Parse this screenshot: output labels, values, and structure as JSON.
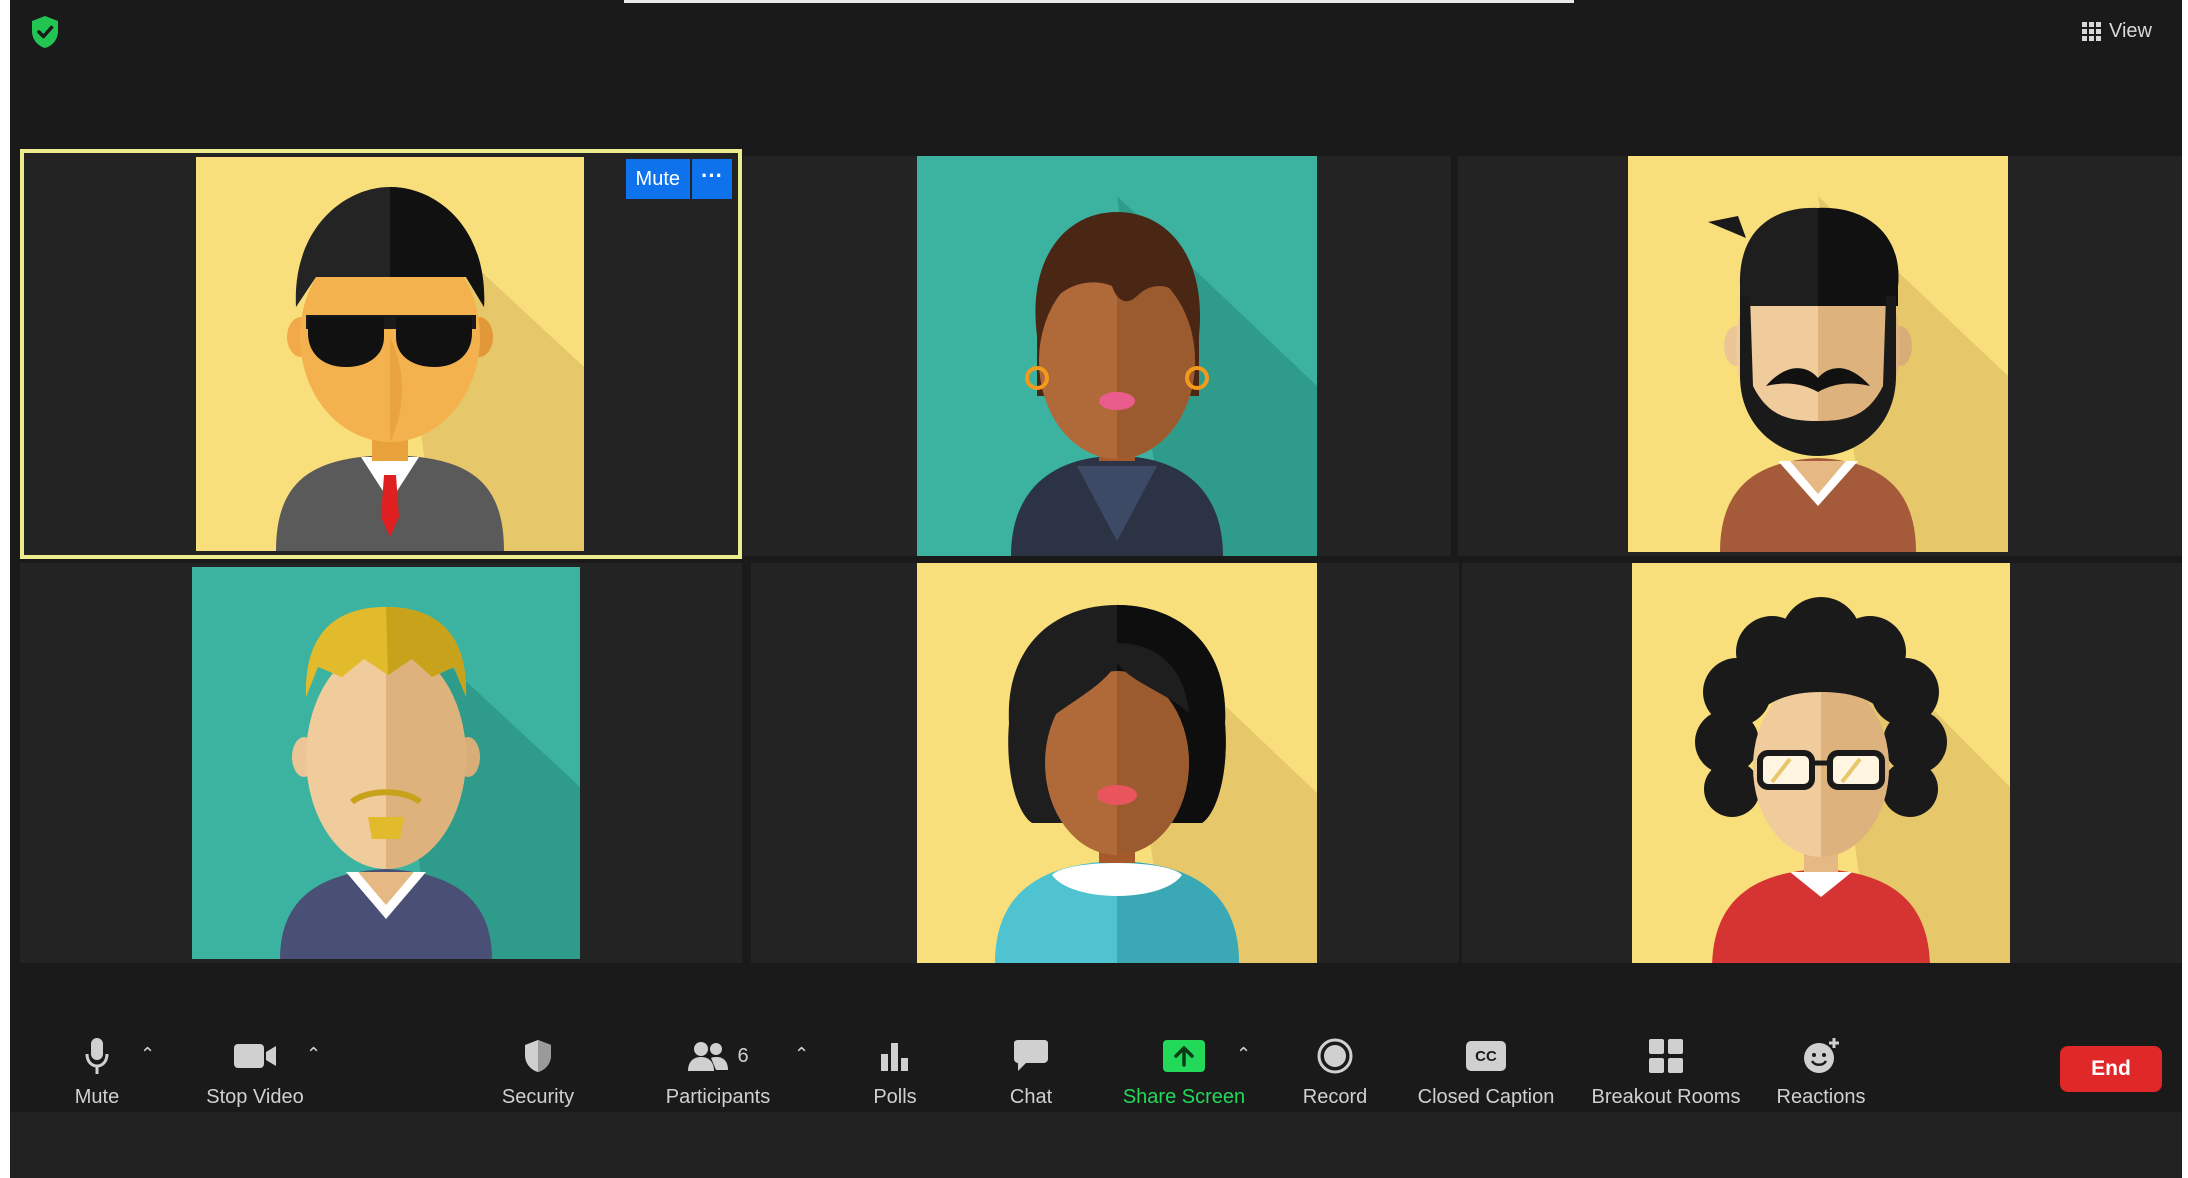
{
  "header": {
    "view_label": "View"
  },
  "active_tile": {
    "mute_label": "Mute",
    "more_label": "···"
  },
  "toolbar": {
    "mute": "Mute",
    "stop_video": "Stop Video",
    "security": "Security",
    "participants": "Participants",
    "participant_count": "6",
    "polls": "Polls",
    "chat": "Chat",
    "share_screen": "Share Screen",
    "record": "Record",
    "closed_caption": "Closed Caption",
    "breakout_rooms": "Breakout Rooms",
    "reactions": "Reactions",
    "end": "End"
  },
  "colors": {
    "accent_blue": "#0e72ed",
    "share_green": "#23d959",
    "end_red": "#e02828",
    "active_border": "#ecec8e",
    "tile_yellow": "#f9df7b",
    "tile_teal": "#3bb3a0"
  }
}
